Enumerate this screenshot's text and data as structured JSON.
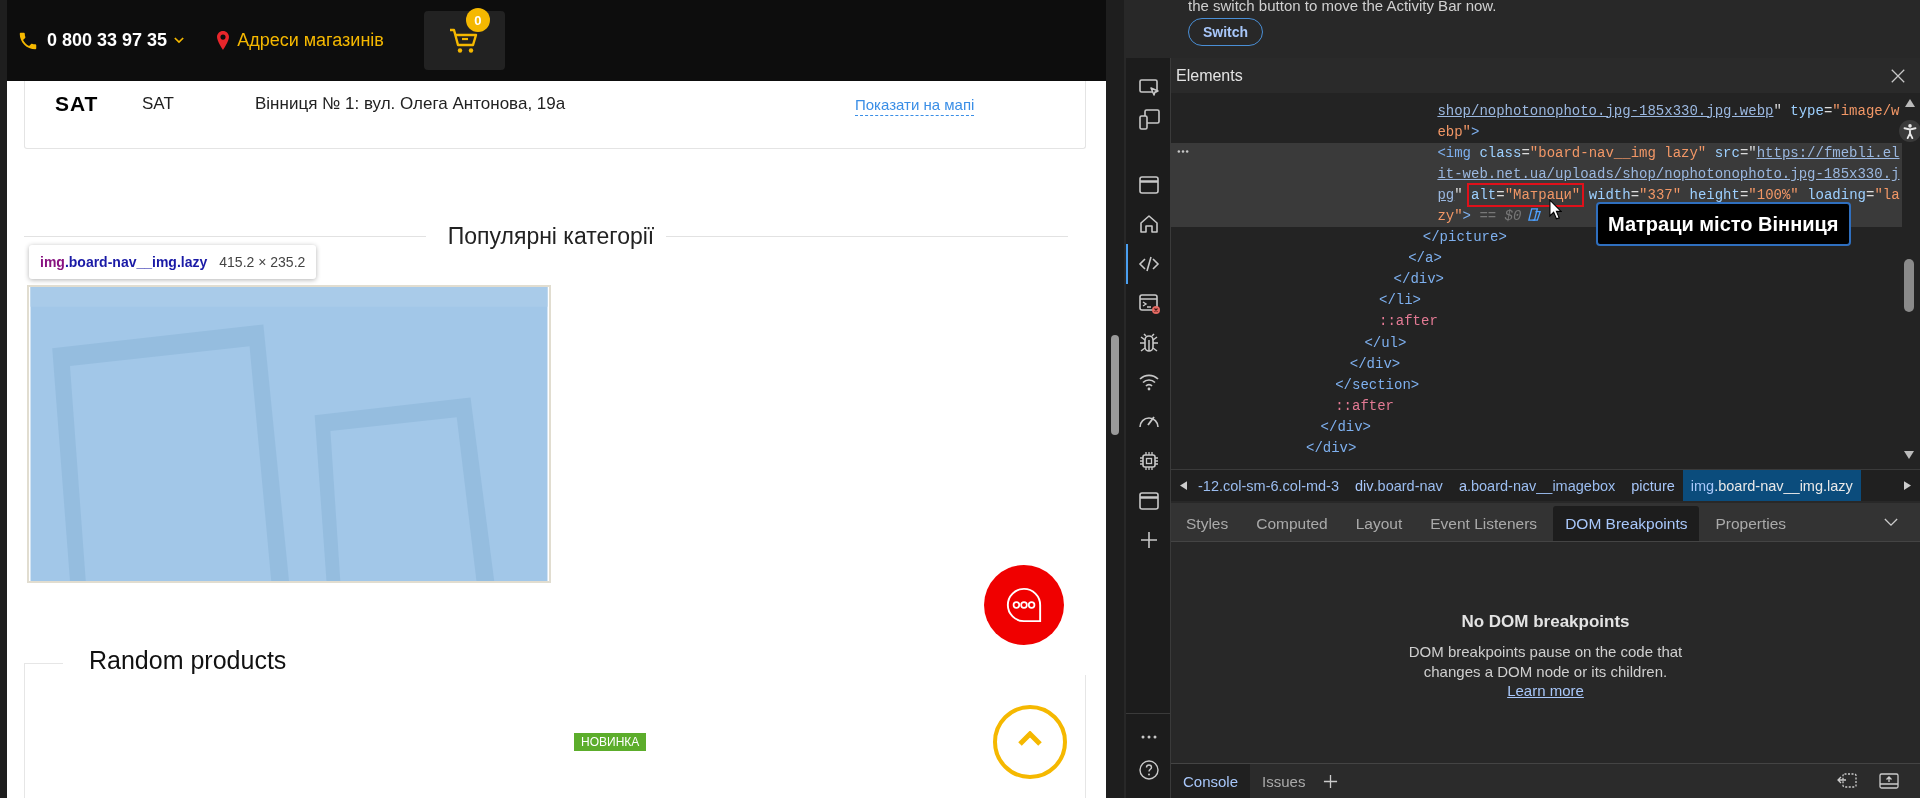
{
  "site": {
    "header": {
      "phone": "0 800 33 97 35",
      "stores_link": "Адреси магазинів",
      "cart_count": "0"
    },
    "store": {
      "logo": "SAT",
      "name": "SAT",
      "address": "Вінниця № 1: вул. Олега Антонова, 19а",
      "map_link": "Показати на мапі"
    },
    "popular_title": "Популярні категорії",
    "inspect_tooltip": {
      "element": "img",
      "classes": ".board-nav__img.lazy",
      "size": "415.2 × 235.2"
    },
    "random_title": "Random products",
    "product_badge": "НОВИНКА"
  },
  "devtools": {
    "notice": "the switch button to move the Activity Bar now.",
    "notice_button": "Switch",
    "activity_bar": {
      "top": [
        {
          "kind": "inspect",
          "selected": false
        },
        {
          "kind": "device",
          "selected": false
        }
      ],
      "tools": [
        {
          "kind": "window",
          "selected": false
        },
        {
          "kind": "home",
          "selected": false
        },
        {
          "kind": "elements",
          "selected": true
        },
        {
          "kind": "console",
          "selected": false
        },
        {
          "kind": "bug",
          "selected": false
        },
        {
          "kind": "wifi",
          "selected": false
        },
        {
          "kind": "gauge",
          "selected": false
        },
        {
          "kind": "chip",
          "selected": false
        },
        {
          "kind": "window",
          "selected": false
        },
        {
          "kind": "plus",
          "selected": false
        }
      ],
      "bottom": [
        {
          "kind": "more",
          "selected": false
        },
        {
          "kind": "help",
          "selected": false
        }
      ]
    },
    "panel_title": "Elements",
    "dom_tree": {
      "kind": "element",
      "close": "</div>",
      "children": [
        {
          "kind": "element",
          "close": "</div>",
          "children": [
            {
              "kind": "element",
              "close": "</section>",
              "children": [
                {
                  "kind": "element",
                  "close": "</div>",
                  "children": [
                    {
                      "kind": "element",
                      "close": "</ul>",
                      "children": [
                        {
                          "kind": "element",
                          "close": "</li>",
                          "children": [
                            {
                              "kind": "element",
                              "close": "</div>",
                              "children": [
                                {
                                  "kind": "element",
                                  "close": "</a>",
                                  "children": [
                                    {
                                      "kind": "element",
                                      "close": "</picture>",
                                      "children": [
                                        {
                                          "kind": "tag",
                                          "selected": false,
                                          "tokens": [
                                            {
                                              "kind": "link",
                                              "text": "shop/nophotonophoto.jpg-185x330.jpg.webp"
                                            },
                                            {
                                              "kind": "punct",
                                              "text": "\""
                                            },
                                            {
                                              "kind": "attr",
                                              "text": " type"
                                            },
                                            {
                                              "kind": "punct",
                                              "text": "="
                                            },
                                            {
                                              "kind": "value",
                                              "text": "\"image/webp\""
                                            },
                                            {
                                              "kind": "tag",
                                              "text": ">"
                                            }
                                          ]
                                        },
                                        {
                                          "kind": "tag",
                                          "selected": true,
                                          "tokens": [
                                            {
                                              "kind": "tag",
                                              "text": "<img"
                                            },
                                            {
                                              "kind": "attr",
                                              "text": " class"
                                            },
                                            {
                                              "kind": "punct",
                                              "text": "="
                                            },
                                            {
                                              "kind": "value",
                                              "text": "\"board-nav__img lazy\""
                                            },
                                            {
                                              "kind": "attr",
                                              "text": " src"
                                            },
                                            {
                                              "kind": "punct",
                                              "text": "=\""
                                            },
                                            {
                                              "kind": "link",
                                              "text": "https://fmebli.elit-web.net.ua/uploads/shop/nophotonophoto.jpg-185x330.jpg"
                                            },
                                            {
                                              "kind": "punct",
                                              "text": "\" "
                                            },
                                            {
                                              "kind": "marked",
                                              "tokens": [
                                                {
                                                  "kind": "attr",
                                                  "text": "alt"
                                                },
                                                {
                                                  "kind": "punct",
                                                  "text": "="
                                                },
                                                {
                                                  "kind": "value",
                                                  "text": "\"Матраци\""
                                                }
                                              ]
                                            },
                                            {
                                              "kind": "attr",
                                              "text": " width"
                                            },
                                            {
                                              "kind": "punct",
                                              "text": "="
                                            },
                                            {
                                              "kind": "value",
                                              "text": "\"337\""
                                            },
                                            {
                                              "kind": "attr",
                                              "text": " height"
                                            },
                                            {
                                              "kind": "punct",
                                              "text": "="
                                            },
                                            {
                                              "kind": "value",
                                              "text": "\"100%\""
                                            },
                                            {
                                              "kind": "attr",
                                              "text": " loading"
                                            },
                                            {
                                              "kind": "punct",
                                              "text": "="
                                            },
                                            {
                                              "kind": "value",
                                              "text": "\"lazy\""
                                            },
                                            {
                                              "kind": "tag",
                                              "text": ">"
                                            },
                                            {
                                              "kind": "ref",
                                              "text": " == $0"
                                            }
                                          ]
                                        }
                                      ]
                                    }
                                  ]
                                }
                              ]
                            }
                          ]
                        },
                        {
                          "kind": "pseudo",
                          "text": "::after"
                        }
                      ]
                    }
                  ]
                }
              ]
            },
            {
              "kind": "pseudo",
              "text": "::after"
            }
          ]
        }
      ]
    },
    "attr_tooltip": "Матраци місто Вінниця",
    "breadcrumbs": [
      {
        "classes": "-12.col-sm-6.col-md-3",
        "selected": false
      },
      {
        "tag": "div",
        "classes": ".board-nav",
        "selected": false
      },
      {
        "tag": "a",
        "classes": ".board-nav__imagebox",
        "selected": false
      },
      {
        "tag": "picture",
        "selected": false
      },
      {
        "tag": "img",
        "classes": ".board-nav__img.lazy",
        "selected": true
      }
    ],
    "tabs": [
      {
        "label": "Styles",
        "selected": false
      },
      {
        "label": "Computed",
        "selected": false
      },
      {
        "label": "Layout",
        "selected": false
      },
      {
        "label": "Event Listeners",
        "selected": false
      },
      {
        "label": "DOM Breakpoints",
        "selected": true
      },
      {
        "label": "Properties",
        "selected": false
      }
    ],
    "empty_state": {
      "title": "No DOM breakpoints",
      "text": "DOM breakpoints pause on the code that changes a DOM node or its children.",
      "link": "Learn more"
    },
    "drawer_tabs": [
      {
        "label": "Console",
        "selected": true
      },
      {
        "label": "Issues",
        "selected": false
      }
    ]
  }
}
